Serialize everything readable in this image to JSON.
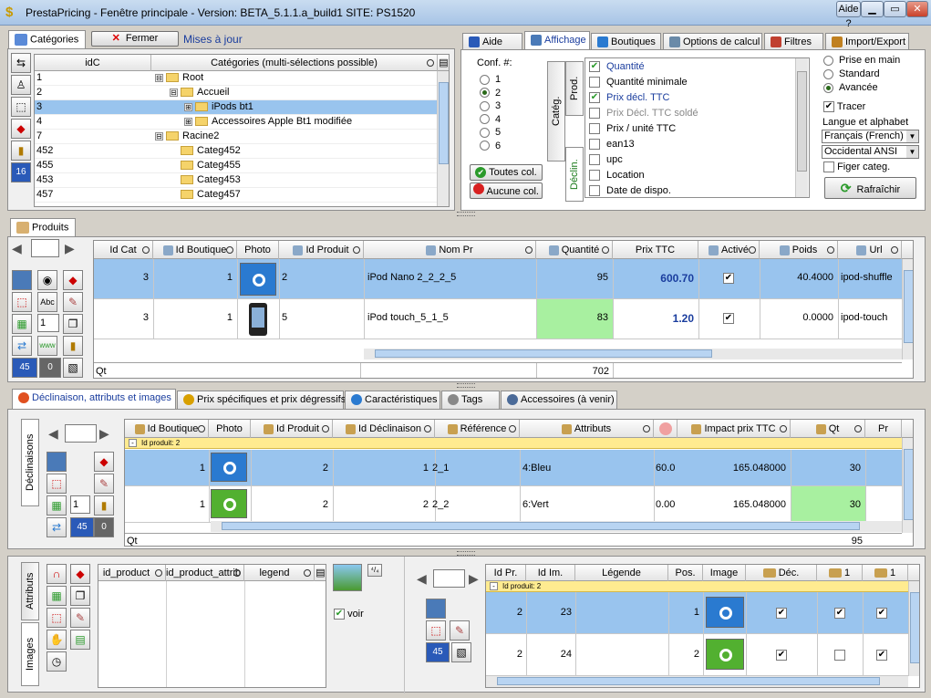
{
  "window": {
    "title": "PrestaPricing - Fenêtre principale  -  Version:  BETA_5.1.1.a_build1    SITE: PS1520",
    "btn_help": "Aide ?",
    "btn_min": "▭",
    "btn_close": "✕"
  },
  "categories": {
    "tab": "Catégories",
    "close": "Fermer",
    "update": "Mises à jour",
    "col_id": "idC",
    "col_cat": "Catégories (multi-sélections possible)",
    "badge": "16",
    "rows": [
      {
        "id": "1",
        "name": "Root",
        "lvl": 0,
        "exp": "⊟"
      },
      {
        "id": "2",
        "name": "Accueil",
        "lvl": 1,
        "exp": "⊟"
      },
      {
        "id": "3",
        "name": "iPods bt1",
        "lvl": 2,
        "exp": "⊞"
      },
      {
        "id": "4",
        "name": "Accessoires Apple Bt1 modifiée",
        "lvl": 2,
        "exp": "⊞"
      },
      {
        "id": "7",
        "name": "Racine2",
        "lvl": 0,
        "exp": "⊟"
      },
      {
        "id": "452",
        "name": "Categ452",
        "lvl": 1,
        "exp": ""
      },
      {
        "id": "455",
        "name": "Categ455",
        "lvl": 1,
        "exp": ""
      },
      {
        "id": "453",
        "name": "Categ453",
        "lvl": 1,
        "exp": ""
      },
      {
        "id": "457",
        "name": "Categ457",
        "lvl": 1,
        "exp": ""
      }
    ]
  },
  "display": {
    "tabs": [
      "Aide",
      "Affichage",
      "Boutiques",
      "Options de calcul",
      "Filtres",
      "Import/Export"
    ],
    "conf_label": "Conf. #:",
    "conf_options": [
      "1",
      "2",
      "3",
      "4",
      "5",
      "6"
    ],
    "btn_all": "Toutes col.",
    "btn_none": "Aucune col.",
    "vtab_categ": "Catég.",
    "vtab_prod": "Prod.",
    "vtab_decl": "Déclin.",
    "columns": [
      {
        "label": "Quantité",
        "checked": true,
        "style": "blue"
      },
      {
        "label": "Quantité minimale",
        "checked": false,
        "style": "normal"
      },
      {
        "label": "Prix décl. TTC",
        "checked": true,
        "style": "blue"
      },
      {
        "label": "Prix Décl. TTC soldé",
        "checked": false,
        "style": "gray"
      },
      {
        "label": "Prix / unité TTC",
        "checked": false,
        "style": "normal"
      },
      {
        "label": "ean13",
        "checked": false,
        "style": "normal"
      },
      {
        "label": "upc",
        "checked": false,
        "style": "normal"
      },
      {
        "label": "Location",
        "checked": false,
        "style": "normal"
      },
      {
        "label": "Date de dispo.",
        "checked": false,
        "style": "normal"
      }
    ],
    "modes": [
      "Prise en main",
      "Standard",
      "Avancée"
    ],
    "trace": "Tracer",
    "lang_label": "Langue et alphabet",
    "lang": "Français (French)",
    "alphabet": "Occidental ANSI",
    "freeze": "Figer categ.",
    "refresh": "Rafraîchir"
  },
  "products": {
    "tab": "Produits",
    "headers": [
      "Id Cat",
      "Id Boutique",
      "Photo",
      "Id Produit",
      "Nom Pr",
      "Quantité",
      "Prix TTC",
      "Activé",
      "Poids",
      "Url"
    ],
    "badge_count": "45",
    "badge_zero": "0",
    "field_val": "1",
    "rows": [
      {
        "idcat": "3",
        "idb": "1",
        "idp": "2",
        "name": "iPod Nano 2_2_2_5",
        "qty": "95",
        "price": "600.70",
        "active": "✔",
        "weight": "40.4000",
        "url": "ipod-shuffle"
      },
      {
        "idcat": "3",
        "idb": "1",
        "idp": "5",
        "name": "iPod touch_5_1_5",
        "qty": "83",
        "price": "1.20",
        "active": "✔",
        "weight": "0.0000",
        "url": "ipod-touch"
      }
    ],
    "footer_label": "Qt",
    "footer_total": "702"
  },
  "variants": {
    "tabs": [
      "Déclinaison, attributs et images",
      "Prix spécifiques et prix dégressifs",
      "Caractéristiques",
      "Tags",
      "Accessoires (à venir)"
    ],
    "vtab": "Déclinaisons",
    "headers": [
      "Id Boutique",
      "Photo",
      "Id Produit",
      "Id Déclinaison",
      "Référence",
      "Attributs",
      "",
      "Impact prix TTC",
      "Qt",
      "Pr"
    ],
    "group_label": "Id produit:   2",
    "field_val": "1",
    "badge_count": "45",
    "badge_zero": "0",
    "rows": [
      {
        "idb": "1",
        "idp": "2",
        "idd": "1",
        "ref": "2_1",
        "attr": "4:Bleu",
        "c7": "60.0",
        "impact": "165.048000",
        "qt": "30"
      },
      {
        "idb": "1",
        "idp": "2",
        "idd": "2",
        "ref": "2_2",
        "attr": "6:Vert",
        "c7": "0.00",
        "impact": "165.048000",
        "qt": "30"
      }
    ],
    "footer_label": "Qt",
    "footer_total": "95"
  },
  "attributes": {
    "vtab_attr": "Attributs",
    "vtab_images": "Images",
    "headers": [
      "id_product",
      "id_product_attrib",
      "legend"
    ],
    "see": "voir"
  },
  "images": {
    "headers": [
      "Id Pr.",
      "Id Im.",
      "Légende",
      "Pos.",
      "Image",
      "Déc.",
      "1",
      "1"
    ],
    "group_label": "Id produit:   2",
    "badge_count": "45",
    "rows": [
      {
        "idp": "2",
        "idi": "23",
        "legend": "",
        "pos": "1",
        "c1": "✔",
        "c2": "✔",
        "c3": "✔"
      },
      {
        "idp": "2",
        "idi": "24",
        "legend": "",
        "pos": "2",
        "c1": "✔",
        "c2": "",
        "c3": "✔"
      }
    ]
  },
  "colors": {
    "selection": "#99c4ee",
    "qty_green": "#a8f0a0",
    "price_blue": "#1a3d9e",
    "ipod_blue": "#2a7ad0",
    "ipod_green": "#52b030"
  }
}
